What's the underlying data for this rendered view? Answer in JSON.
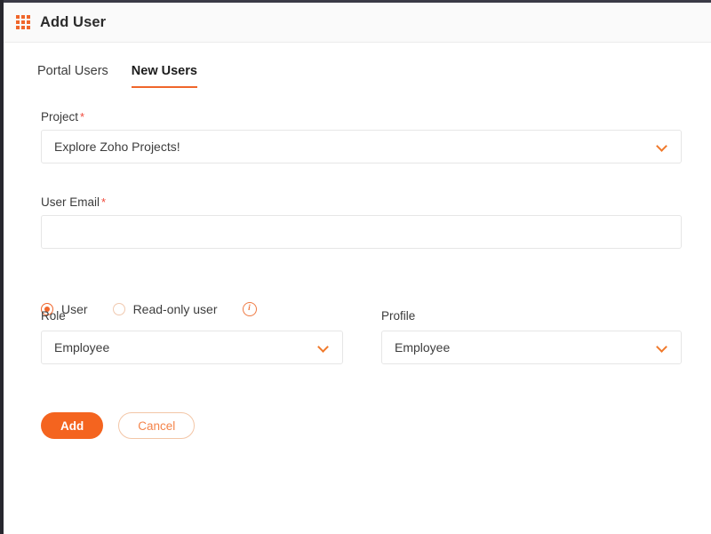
{
  "window": {
    "header": {
      "title": "Add User",
      "app_grid_icon": "grid-apps-icon"
    }
  },
  "tabs": [
    {
      "label": "Portal Users",
      "active": false
    },
    {
      "label": "New Users",
      "active": true
    }
  ],
  "form": {
    "project": {
      "label": "Project",
      "required_marker": "*",
      "value": "Explore Zoho Projects!",
      "chevron_icon": "chevron-down-icon"
    },
    "user_email": {
      "label": "User Email",
      "required_marker": "*",
      "value": "",
      "placeholder": ""
    },
    "user_type": {
      "options": [
        {
          "label": "User",
          "selected": true
        },
        {
          "label": "Read-only user",
          "selected": false
        }
      ],
      "info_icon": "info-icon"
    },
    "role": {
      "label": "Role",
      "value": "Employee",
      "chevron_icon": "chevron-down-icon"
    },
    "profile": {
      "label": "Profile",
      "value": "Employee",
      "chevron_icon": "chevron-down-icon"
    }
  },
  "actions": {
    "submit_label": "Add",
    "cancel_label": "Cancel"
  },
  "colors": {
    "accent": "#f0662b",
    "primary_button": "#f4641f",
    "required_asterisk": "#f04a3c",
    "header_bg": "#fafafa",
    "window_edge": "#27272e"
  }
}
